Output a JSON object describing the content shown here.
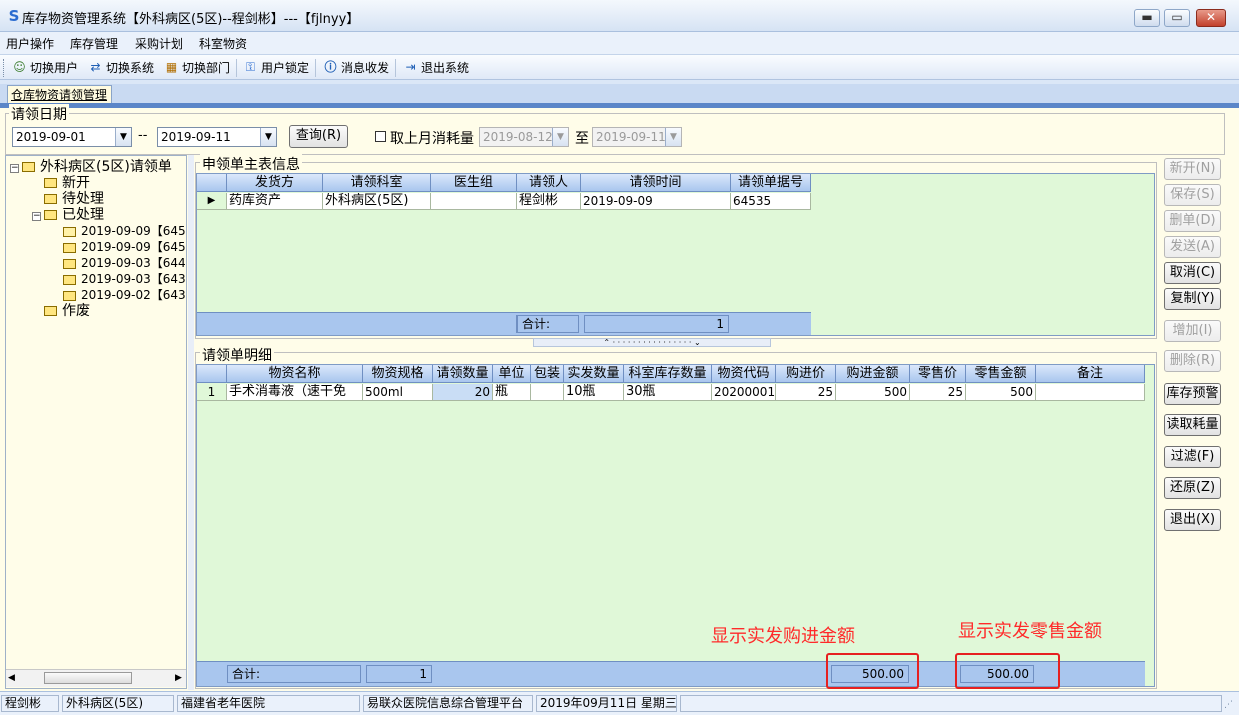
{
  "window": {
    "title": "库存物资管理系统【外科病区(5区)--程剑彬】---【fjlnyy】",
    "min": "▬",
    "max": "▭",
    "close": "✕"
  },
  "menu": [
    "用户操作",
    "库存管理",
    "采购计划",
    "科室物资"
  ],
  "toolbar": [
    {
      "label": "切换用户",
      "icon": "switch-user-icon"
    },
    {
      "label": "切换系统",
      "icon": "switch-system-icon"
    },
    {
      "label": "切换部门",
      "icon": "switch-dept-icon"
    },
    {
      "label": "用户锁定",
      "icon": "lock-user-icon"
    },
    {
      "label": "消息收发",
      "icon": "info-icon"
    },
    {
      "label": "退出系统",
      "icon": "exit-icon"
    }
  ],
  "tab": {
    "label": "仓库物资请领管理"
  },
  "date_filter": {
    "legend": "请领日期",
    "start": "2019-09-01",
    "sep": "--",
    "end": "2019-09-11",
    "query_btn": "查询(R)",
    "checkbox_label": "取上月消耗量",
    "prev_start": "2019-08-12",
    "to": "至",
    "prev_end": "2019-09-11"
  },
  "tree": {
    "root": "外科病区(5区)请领单",
    "new": "新开",
    "pending": "待处理",
    "processed": "已处理",
    "items": [
      "2019-09-09【645",
      "2019-09-09【645",
      "2019-09-03【644",
      "2019-09-03【643",
      "2019-09-02【643"
    ],
    "void": "作废"
  },
  "master": {
    "legend": "申领单主表信息",
    "columns": [
      "发货方",
      "请领科室",
      "医生组",
      "请领人",
      "请领时间",
      "请领单据号"
    ],
    "rows": [
      [
        "药库资产",
        "外科病区(5区)",
        "",
        "程剑彬",
        "2019-09-09",
        "64535"
      ]
    ],
    "total_label": "合计:",
    "total_value": "1",
    "row_marker": "▶"
  },
  "detail": {
    "legend": "请领单明细",
    "columns": [
      "物资名称",
      "物资规格",
      "请领数量",
      "单位",
      "包装",
      "实发数量",
      "科室库存数量",
      "物资代码",
      "购进价",
      "购进金额",
      "零售价",
      "零售金额",
      "备注"
    ],
    "rows": [
      [
        "1",
        "手术消毒液（速干免",
        "500ml",
        "20",
        "瓶",
        "",
        "10瓶",
        "30瓶",
        "20200001",
        "25",
        "500",
        "25",
        "500",
        ""
      ]
    ],
    "total_label": "合计:",
    "total_count": "1",
    "total_purchase": "500.00",
    "total_retail": "500.00"
  },
  "buttons": [
    {
      "label": "新开(N)",
      "enabled": false
    },
    {
      "label": "保存(S)",
      "enabled": false
    },
    {
      "label": "删单(D)",
      "enabled": false
    },
    {
      "label": "发送(A)",
      "enabled": false
    },
    {
      "label": "取消(C)",
      "enabled": true
    },
    {
      "label": "复制(Y)",
      "enabled": true
    },
    {
      "label": "增加(I)",
      "enabled": false
    },
    {
      "label": "删除(R)",
      "enabled": false
    },
    {
      "label": "库存预警",
      "enabled": true
    },
    {
      "label": "读取耗量",
      "enabled": true
    },
    {
      "label": "过滤(F)",
      "enabled": true
    },
    {
      "label": "还原(Z)",
      "enabled": true
    },
    {
      "label": "退出(X)",
      "enabled": true
    }
  ],
  "annotations": {
    "purchase": "显示实发购进金额",
    "retail": "显示实发零售金额"
  },
  "status": [
    "程剑彬",
    "外科病区(5区)",
    "福建省老年医院",
    "易联众医院信息综合管理平台",
    "2019年09月11日 星期三"
  ],
  "colors": {
    "accent": "#5b86c8",
    "grid": "#e0f8d8",
    "annotation": "#e62020"
  }
}
